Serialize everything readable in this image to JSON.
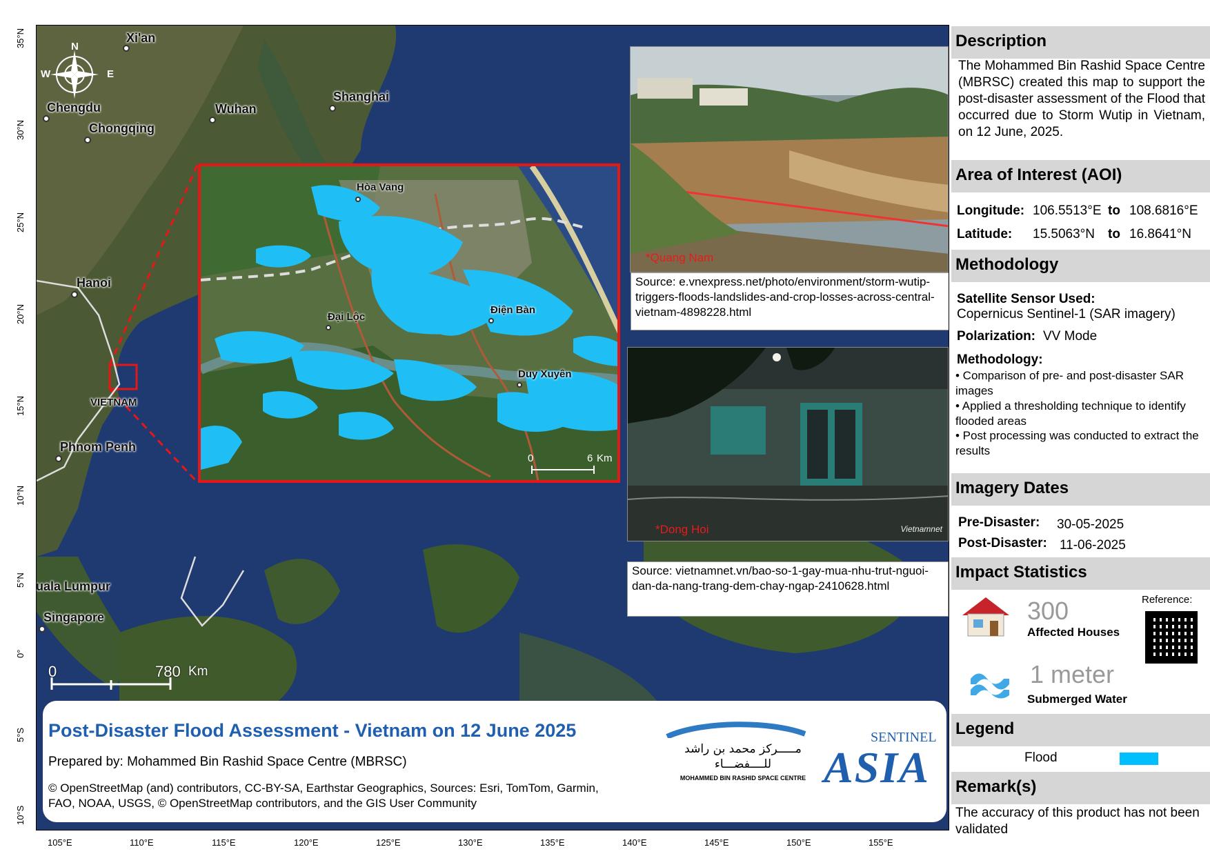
{
  "map": {
    "cities": [
      {
        "name": "Xi'an"
      },
      {
        "name": "Chengdu"
      },
      {
        "name": "Chongqing"
      },
      {
        "name": "Wuhan"
      },
      {
        "name": "Shanghai"
      },
      {
        "name": "Hanoi"
      },
      {
        "name": "VIETNAM"
      },
      {
        "name": "Phnom Penh"
      },
      {
        "name": "Kuala Lumpur"
      },
      {
        "name": "Singapore"
      }
    ],
    "longitude_ticks": [
      "105°E",
      "110°E",
      "115°E",
      "120°E",
      "125°E",
      "130°E",
      "135°E",
      "140°E",
      "145°E",
      "150°E",
      "155°E"
    ],
    "latitude_ticks": [
      "35°N",
      "30°N",
      "25°N",
      "20°N",
      "15°N",
      "10°N",
      "5°N",
      "0°",
      "5°S",
      "10°S"
    ],
    "compass": {
      "n": "N",
      "e": "E",
      "w": "W"
    },
    "scale": {
      "start": "0",
      "end": "780",
      "unit": "Km"
    },
    "inset": {
      "cities": [
        "Hòa Vang",
        "Đại Lộc",
        "Điện Bàn",
        "Duy Xuyên"
      ],
      "scale": {
        "start": "0",
        "end": "6",
        "unit": "Km"
      }
    }
  },
  "photos": [
    {
      "tag": "*Quang Nam",
      "caption": "Source: e.vnexpress.net/photo/environment/storm-wutip-triggers-floods-landslides-and-crop-losses-across-central-vietnam-4898228.html"
    },
    {
      "tag": "*Dong Hoi",
      "caption": "Source: vietnamnet.vn/bao-so-1-gay-mua-nhu-trut-nguoi-dan-da-nang-trang-dem-chay-ngap-2410628.html",
      "watermark": "Vietnamnet"
    }
  ],
  "title_box": {
    "title": "Post-Disaster Flood Assessment - Vietnam on 12 June 2025",
    "prepared_by": "Prepared by: Mohammed Bin Rashid Space Centre (MBRSC)",
    "credits": "© OpenStreetMap (and) contributors, CC-BY-SA, Earthstar Geographics, Sources: Esri, TomTom, Garmin, FAO, NOAA, USGS, © OpenStreetMap contributors, and the GIS User Community",
    "mbrsc_logo_text_ar": "مـــــركز محمد بن راشد للــــفضـــاء",
    "mbrsc_logo_text_en": "MOHAMMED BIN RASHID SPACE CENTRE",
    "sentinel_logo_top": "SENTINEL",
    "sentinel_logo_main": "ASIA"
  },
  "panel": {
    "description": {
      "heading": "Description",
      "text": "The Mohammed Bin Rashid Space Centre (MBRSC) created this map to support the post-disaster assessment of the Flood that occurred due to Storm Wutip in Vietnam, on 12 June, 2025."
    },
    "aoi": {
      "heading": "Area of Interest (AOI)",
      "longitude_label": "Longitude:",
      "longitude_from": "106.5513°E",
      "longitude_to": "108.6816°E",
      "latitude_label": "Latitude:",
      "latitude_from": "15.5063°N",
      "latitude_to": "16.8641°N",
      "to": "to"
    },
    "methodology": {
      "heading": "Methodology",
      "sensor_label": "Satellite Sensor Used:",
      "sensor_value": "Copernicus Sentinel-1  (SAR imagery)",
      "polarization_label": "Polarization:",
      "polarization_value": "VV Mode",
      "method_label": "Methodology:",
      "steps": [
        "• Comparison of pre- and post-disaster SAR  images",
        "• Applied a thresholding technique to identify flooded areas",
        "• Post processing was conducted to extract the results"
      ]
    },
    "imagery_dates": {
      "heading": "Imagery Dates",
      "pre_label": "Pre-Disaster:",
      "pre_value": "30-05-2025",
      "post_label": "Post-Disaster:",
      "post_value": "11-06-2025"
    },
    "impact": {
      "heading": "Impact Statistics",
      "reference_label": "Reference:",
      "houses_value": "300",
      "houses_label": "Affected Houses",
      "water_value": "1 meter",
      "water_label": "Submerged Water"
    },
    "legend": {
      "heading": "Legend",
      "items": [
        {
          "label": "Flood",
          "color": "#00bfff"
        }
      ]
    },
    "remarks": {
      "heading": "Remark(s)",
      "text": "The accuracy of this product has not been validated"
    }
  },
  "colors": {
    "title_blue": "#1f5fae",
    "inset_border": "#e61717",
    "flood": "#00bfff",
    "header_gray": "#d6d6d6"
  }
}
